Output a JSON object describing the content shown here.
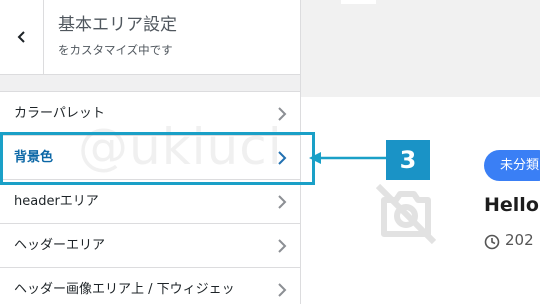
{
  "sidebar": {
    "back_icon": "chevron-left-icon",
    "title": "基本エリア設定",
    "subtitle": "をカスタマイズ中です",
    "items": [
      {
        "label": "カラーパレット"
      },
      {
        "label": "背景色",
        "active": true
      },
      {
        "label": "headerエリア"
      },
      {
        "label": "ヘッダーエリア"
      },
      {
        "label": "ヘッダー画像エリア上 / 下ウィジェッ"
      }
    ]
  },
  "preview": {
    "category_badge": "未分類",
    "post_title": "Hello",
    "date_prefix": "202"
  },
  "annotation": {
    "step_number": "3",
    "watermark": "@ukiuci",
    "highlight_color": "#1aa0c7",
    "number_bg_color": "#1a93c6"
  },
  "colors": {
    "badge": "#3a7ff5",
    "active_label": "#0b67a6"
  }
}
